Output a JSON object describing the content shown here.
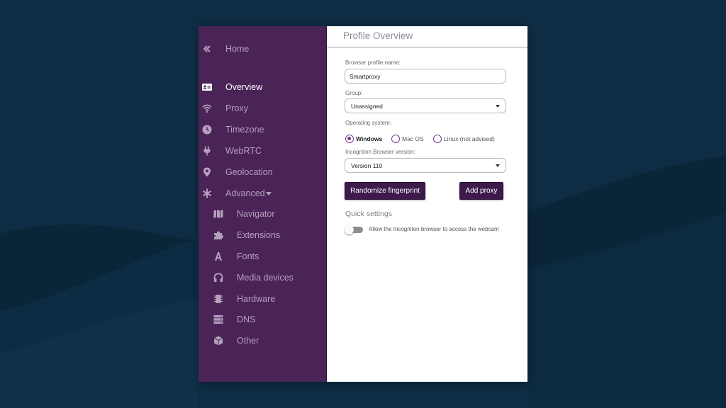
{
  "colors": {
    "background": "#0d2a40",
    "sidebar": "#4a2357",
    "accent": "#7a3a8c",
    "button": "#3e1a4c"
  },
  "sidebar": {
    "collapse_icon": "double-chevron-left-icon",
    "home": {
      "label": "Home"
    },
    "items": [
      {
        "label": "Overview",
        "icon": "id-card-icon",
        "active": true
      },
      {
        "label": "Proxy",
        "icon": "wifi-icon"
      },
      {
        "label": "Timezone",
        "icon": "clock-icon"
      },
      {
        "label": "WebRTC",
        "icon": "plug-icon"
      },
      {
        "label": "Geolocation",
        "icon": "map-pin-icon"
      },
      {
        "label": "Advanced",
        "icon": "asterisk-icon",
        "expanded": true
      }
    ],
    "advanced_items": [
      {
        "label": "Navigator",
        "icon": "map-icon"
      },
      {
        "label": "Extensions",
        "icon": "puzzle-icon"
      },
      {
        "label": "Fonts",
        "icon": "font-icon"
      },
      {
        "label": "Media devices",
        "icon": "headphones-icon"
      },
      {
        "label": "Hardware",
        "icon": "chip-icon"
      },
      {
        "label": "DNS",
        "icon": "server-icon"
      },
      {
        "label": "Other",
        "icon": "cube-icon"
      }
    ]
  },
  "main": {
    "title": "Profile Overview",
    "profile_name": {
      "label": "Browser profile name:",
      "value": "Smartproxy"
    },
    "group": {
      "label": "Group:",
      "value": "Unassigned"
    },
    "os": {
      "label": "Operating system:",
      "options": [
        "Windows",
        "Mac OS",
        "Linux (not advised)"
      ],
      "selected": "Windows"
    },
    "version": {
      "label": "Incogniton Browser version:",
      "value": "Version 110"
    },
    "buttons": {
      "randomize": "Randomize fingerprint",
      "add_proxy": "Add proxy"
    },
    "quick_settings": {
      "title": "Quick settings",
      "webcam_toggle": {
        "label": "Allow the Incogniton browser to access the webcam",
        "on": false
      }
    }
  }
}
